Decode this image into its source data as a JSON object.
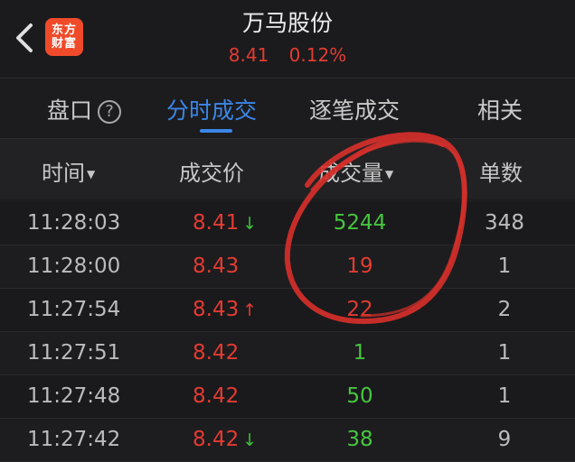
{
  "header": {
    "logo_line1": "东方",
    "logo_line2": "财富",
    "title": "万马股份",
    "price": "8.41",
    "change_pct": "0.12%"
  },
  "tabs": [
    {
      "label": "盘口",
      "active": false
    },
    {
      "label": "分时成交",
      "active": true
    },
    {
      "label": "逐笔成交",
      "active": false
    },
    {
      "label": "相关",
      "active": false
    }
  ],
  "help_icon_glyph": "?",
  "columns": {
    "time": "时间",
    "price": "成交价",
    "volume": "成交量",
    "count": "单数"
  },
  "trades": [
    {
      "time": "11:28:03",
      "price": "8.41",
      "arrow": "↓",
      "volume": "5244",
      "count": "348"
    },
    {
      "time": "11:28:00",
      "price": "8.43",
      "arrow": "",
      "volume": "19",
      "count": "1"
    },
    {
      "time": "11:27:54",
      "price": "8.43",
      "arrow": "↑",
      "volume": "22",
      "count": "2"
    },
    {
      "time": "11:27:51",
      "price": "8.42",
      "arrow": "",
      "volume": "1",
      "count": "1"
    },
    {
      "time": "11:27:48",
      "price": "8.42",
      "arrow": "",
      "volume": "50",
      "count": "1"
    },
    {
      "time": "11:27:42",
      "price": "8.42",
      "arrow": "↓",
      "volume": "38",
      "count": "9"
    }
  ],
  "colors": {
    "accent": "#3b86e8",
    "up": "#e33b32",
    "down": "#46c63f",
    "logo": "#ef4b2a",
    "annotation": "#d9302b"
  }
}
